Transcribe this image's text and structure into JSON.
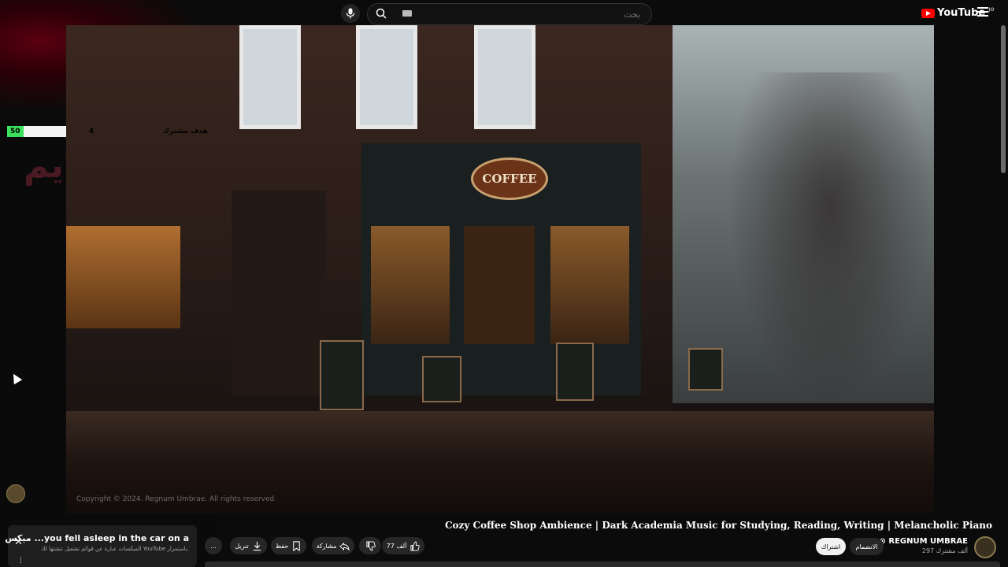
{
  "header": {
    "search_placeholder": "بحث",
    "logo_text": "YouTube",
    "logo_region": "JO"
  },
  "overlay": {
    "goal_label": "هدف مشترك",
    "goal_current": "4",
    "goal_target": "50",
    "goal_progress": 0.08,
    "watermark_text": "البث لايم"
  },
  "video": {
    "sign_text": "COFFEE",
    "copyright": "Copyright © 2024. Regnum Umbrae. All rights reserved",
    "title": "Cozy Coffee Shop Ambience | Dark Academia Music for Studying, Reading, Writing | Melancholic Piano"
  },
  "channel": {
    "name": "REGNUM UMBRAE",
    "subscribers": "297 ألف مشترك",
    "join_label": "الانضمام",
    "subscribe_label": "اشتراك"
  },
  "actions": {
    "like_count": "77 ألف",
    "share_label": "مشاركة",
    "save_label": "حفظ",
    "download_label": "تنزيل",
    "more_label": "..."
  },
  "mini_player": {
    "title": "ميكس ...you fell asleep in the car on a",
    "subtitle": "الميكسات عبارة عن قوائم تشغيل تنشئها لك YouTube باستمرار."
  },
  "colors": {
    "accent": "#ff0000",
    "goal_fill": "#3be05c"
  }
}
